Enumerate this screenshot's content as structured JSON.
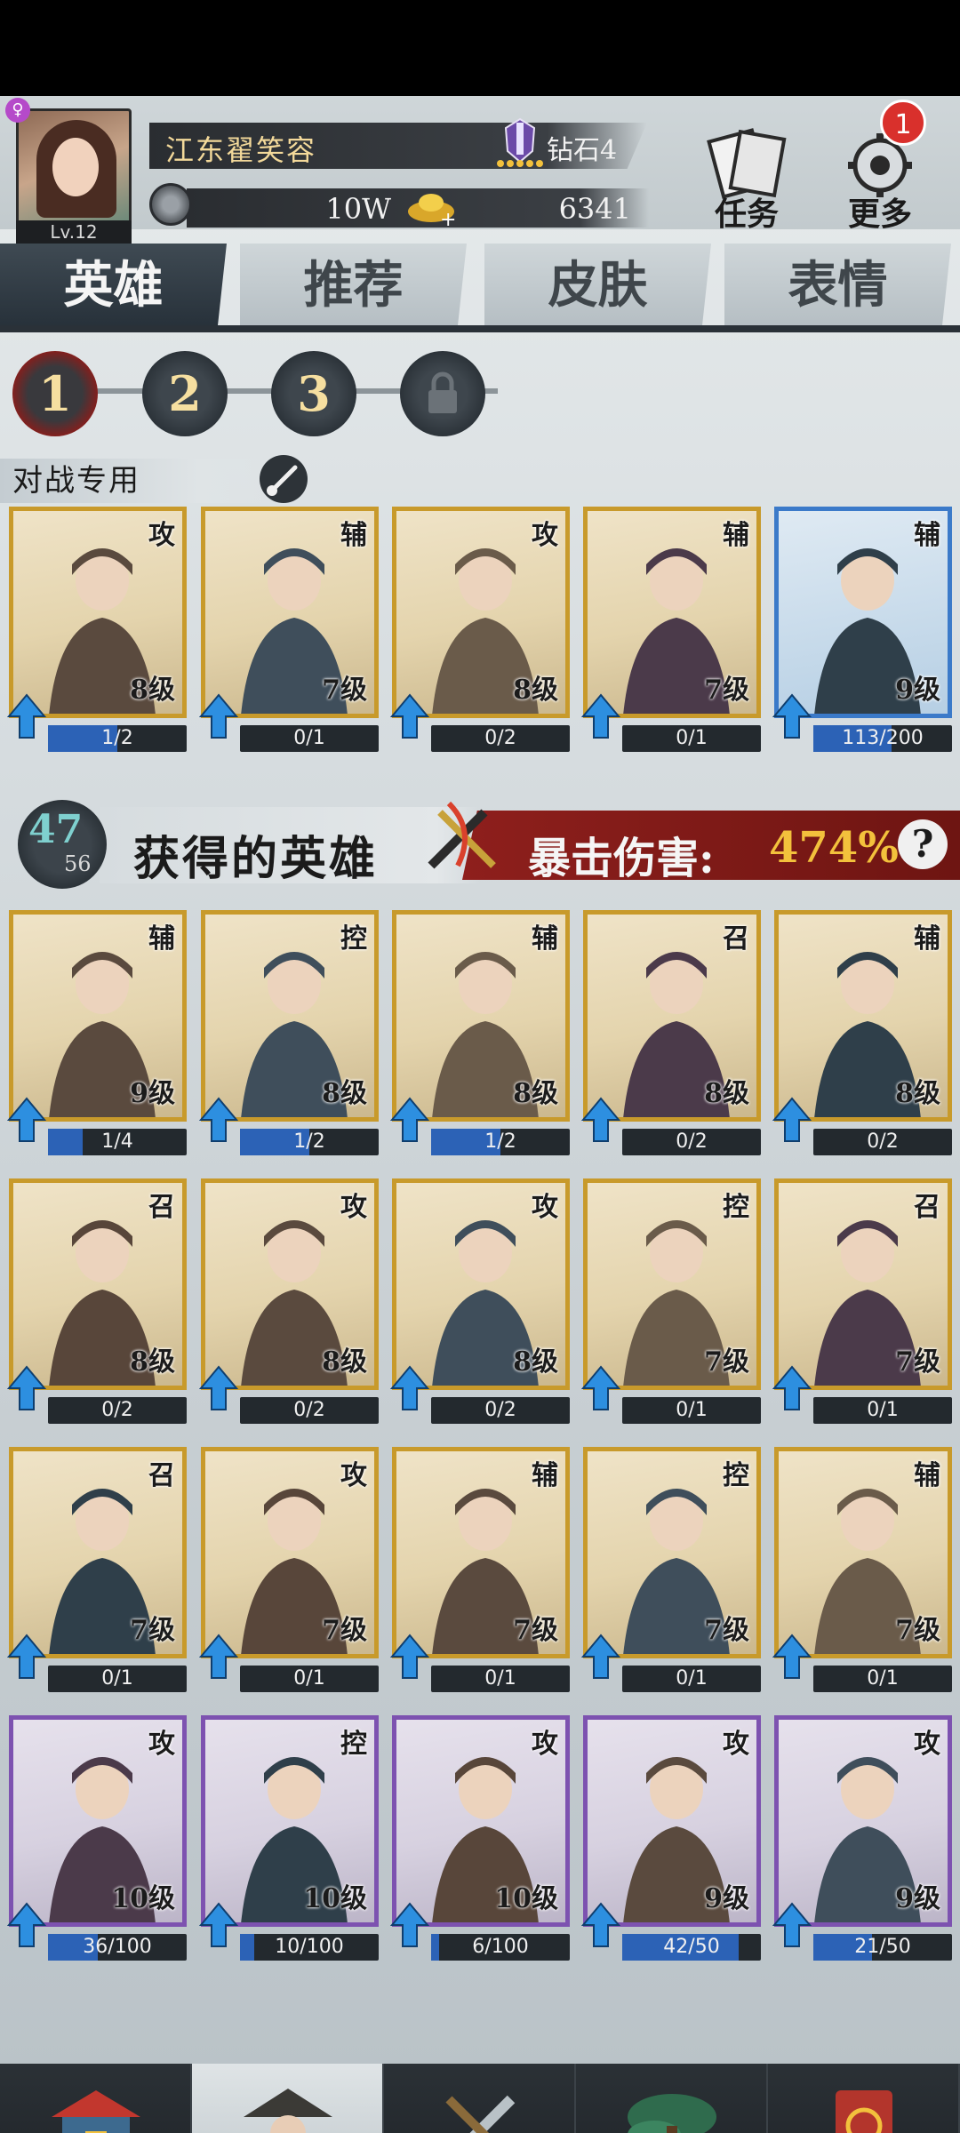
{
  "player": {
    "name": "江东翟笑容",
    "level": "Lv.12",
    "rank": "钻石4",
    "rank_stars": 5,
    "silver": "10W",
    "gold": "6341"
  },
  "top_buttons": {
    "tasks": "任务",
    "more": "更多",
    "more_badge": "1"
  },
  "tabs": [
    "英雄",
    "推荐",
    "皮肤",
    "表情"
  ],
  "pages": [
    "1",
    "2",
    "3"
  ],
  "battle_section": {
    "label": "对战专用"
  },
  "battle_cards": [
    {
      "role": "攻",
      "level": "8级",
      "progress": "1/2",
      "fill": 0.5,
      "frame": "gold"
    },
    {
      "role": "辅",
      "level": "7级",
      "progress": "0/1",
      "fill": 0,
      "frame": "gold"
    },
    {
      "role": "攻",
      "level": "8级",
      "progress": "0/2",
      "fill": 0,
      "frame": "gold"
    },
    {
      "role": "辅",
      "level": "7级",
      "progress": "0/1",
      "fill": 0,
      "frame": "gold"
    },
    {
      "role": "辅",
      "level": "9级",
      "progress": "113/200",
      "fill": 0.565,
      "frame": "blue"
    }
  ],
  "heroes_section": {
    "owned": "47",
    "total": "56",
    "title": "获得的英雄",
    "crit_label": "暴击伤害:",
    "crit_value": "474%",
    "help": "?"
  },
  "hero_cards": [
    {
      "role": "辅",
      "level": "9级",
      "progress": "1/4",
      "fill": 0.25,
      "frame": "gold"
    },
    {
      "role": "控",
      "level": "8级",
      "progress": "1/2",
      "fill": 0.5,
      "frame": "gold"
    },
    {
      "role": "辅",
      "level": "8级",
      "progress": "1/2",
      "fill": 0.5,
      "frame": "gold"
    },
    {
      "role": "召",
      "level": "8级",
      "progress": "0/2",
      "fill": 0,
      "frame": "gold"
    },
    {
      "role": "辅",
      "level": "8级",
      "progress": "0/2",
      "fill": 0,
      "frame": "gold"
    },
    {
      "role": "召",
      "level": "8级",
      "progress": "0/2",
      "fill": 0,
      "frame": "gold"
    },
    {
      "role": "攻",
      "level": "8级",
      "progress": "0/2",
      "fill": 0,
      "frame": "gold"
    },
    {
      "role": "攻",
      "level": "8级",
      "progress": "0/2",
      "fill": 0,
      "frame": "gold"
    },
    {
      "role": "控",
      "level": "7级",
      "progress": "0/1",
      "fill": 0,
      "frame": "gold"
    },
    {
      "role": "召",
      "level": "7级",
      "progress": "0/1",
      "fill": 0,
      "frame": "gold"
    },
    {
      "role": "召",
      "level": "7级",
      "progress": "0/1",
      "fill": 0,
      "frame": "gold"
    },
    {
      "role": "攻",
      "level": "7级",
      "progress": "0/1",
      "fill": 0,
      "frame": "gold"
    },
    {
      "role": "辅",
      "level": "7级",
      "progress": "0/1",
      "fill": 0,
      "frame": "gold"
    },
    {
      "role": "控",
      "level": "7级",
      "progress": "0/1",
      "fill": 0,
      "frame": "gold"
    },
    {
      "role": "辅",
      "level": "7级",
      "progress": "0/1",
      "fill": 0,
      "frame": "gold"
    },
    {
      "role": "攻",
      "level": "10级",
      "progress": "36/100",
      "fill": 0.36,
      "frame": "purple"
    },
    {
      "role": "控",
      "level": "10级",
      "progress": "10/100",
      "fill": 0.1,
      "frame": "purple"
    },
    {
      "role": "攻",
      "level": "10级",
      "progress": "6/100",
      "fill": 0.06,
      "frame": "purple"
    },
    {
      "role": "攻",
      "level": "9级",
      "progress": "42/50",
      "fill": 0.84,
      "frame": "purple"
    },
    {
      "role": "攻",
      "level": "9级",
      "progress": "21/50",
      "fill": 0.42,
      "frame": "purple"
    }
  ],
  "nav": [
    "商城",
    "英雄",
    "战斗",
    "江湖",
    "帮派"
  ],
  "colors": {
    "gold_frame": "#c89a2b",
    "purple_frame": "#7d52b0",
    "blue_frame": "#3b7ac9",
    "crit_value": "#f3c13c",
    "progress_fill": "#2c62b6"
  }
}
